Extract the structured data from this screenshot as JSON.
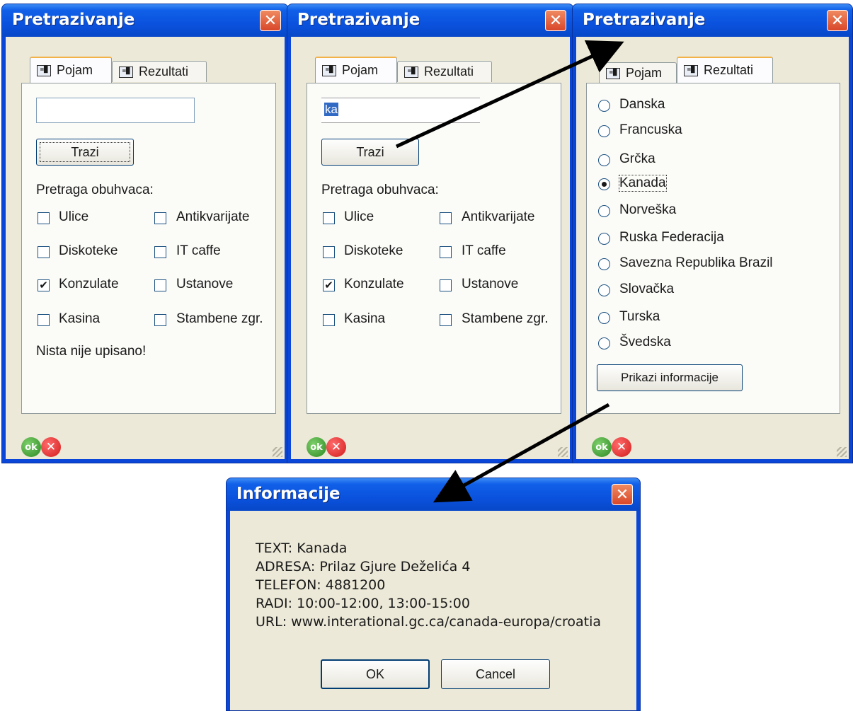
{
  "windows": [
    {
      "title": "Pretrazivanje",
      "close": "✕",
      "tab_pojam": "Pojam",
      "tab_rezultati": "Rezultati",
      "tab_icon": "=█",
      "search_value": "",
      "search_button": "Trazi",
      "scope_label": "Pretraga obuhvaca:",
      "checkboxes": [
        {
          "label": "Ulice",
          "checked": ""
        },
        {
          "label": "Antikvarijate",
          "checked": ""
        },
        {
          "label": "Diskoteke",
          "checked": ""
        },
        {
          "label": "IT caffe",
          "checked": ""
        },
        {
          "label": "Konzulate",
          "checked": "✔"
        },
        {
          "label": "Ustanove",
          "checked": ""
        },
        {
          "label": "Kasina",
          "checked": ""
        },
        {
          "label": "Stambene zgr.",
          "checked": ""
        }
      ],
      "status": "Nista nije upisano!",
      "ok_icon": "ok",
      "cancel_icon": "✕"
    },
    {
      "title": "Pretrazivanje",
      "close": "✕",
      "tab_pojam": "Pojam",
      "tab_rezultati": "Rezultati",
      "tab_icon": "=█",
      "search_value": "ka",
      "search_button": "Trazi",
      "scope_label": "Pretraga obuhvaca:",
      "checkboxes": [
        {
          "label": "Ulice",
          "checked": ""
        },
        {
          "label": "Antikvarijate",
          "checked": ""
        },
        {
          "label": "Diskoteke",
          "checked": ""
        },
        {
          "label": "IT caffe",
          "checked": ""
        },
        {
          "label": "Konzulate",
          "checked": "✔"
        },
        {
          "label": "Ustanove",
          "checked": ""
        },
        {
          "label": "Kasina",
          "checked": ""
        },
        {
          "label": "Stambene zgr.",
          "checked": ""
        }
      ],
      "ok_icon": "ok",
      "cancel_icon": "✕"
    },
    {
      "title": "Pretrazivanje",
      "close": "✕",
      "tab_pojam": "Pojam",
      "tab_rezultati": "Rezultati",
      "tab_icon": "=█",
      "results": [
        "Danska",
        "Francuska",
        "Grčka",
        "Kanada",
        "Norveška",
        "Ruska Federacija",
        "Savezna Republika Brazil",
        "Slovačka",
        "Turska",
        "Švedska"
      ],
      "selected_result": "Kanada",
      "show_button": "Prikazi informacije",
      "ok_icon": "ok",
      "cancel_icon": "✕"
    }
  ],
  "info_dialog": {
    "title": "Informacije",
    "close": "✕",
    "lines": [
      "TEXT: Kanada",
      "ADRESA: Prilaz Gjure Deželića 4",
      "TELEFON: 4881200",
      "RADI: 10:00-12:00, 13:00-15:00",
      "URL: www.interational.gc.ca/canada-europa/croatia"
    ],
    "ok_button": "OK",
    "cancel_button": "Cancel"
  },
  "colors": {
    "titlebar": "#0a52de",
    "dialog_face": "#ece9d8",
    "close_button": "#d8472a",
    "arrow": "#000000"
  }
}
